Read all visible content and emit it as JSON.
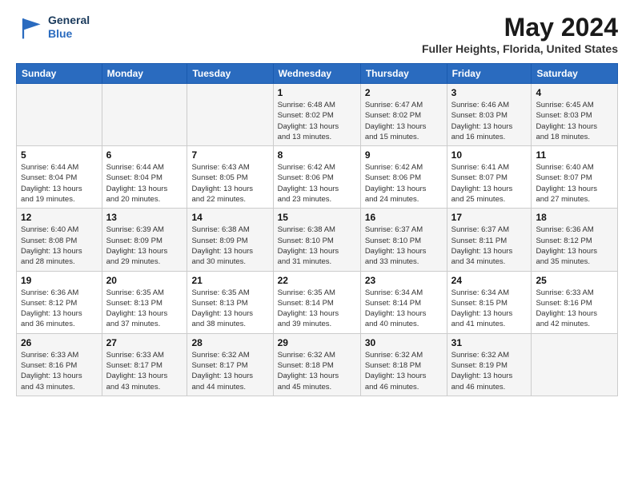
{
  "header": {
    "logo_line1": "General",
    "logo_line2": "Blue",
    "main_title": "May 2024",
    "subtitle": "Fuller Heights, Florida, United States"
  },
  "days_of_week": [
    "Sunday",
    "Monday",
    "Tuesday",
    "Wednesday",
    "Thursday",
    "Friday",
    "Saturday"
  ],
  "weeks": [
    [
      {
        "num": "",
        "info": ""
      },
      {
        "num": "",
        "info": ""
      },
      {
        "num": "",
        "info": ""
      },
      {
        "num": "1",
        "info": "Sunrise: 6:48 AM\nSunset: 8:02 PM\nDaylight: 13 hours\nand 13 minutes."
      },
      {
        "num": "2",
        "info": "Sunrise: 6:47 AM\nSunset: 8:02 PM\nDaylight: 13 hours\nand 15 minutes."
      },
      {
        "num": "3",
        "info": "Sunrise: 6:46 AM\nSunset: 8:03 PM\nDaylight: 13 hours\nand 16 minutes."
      },
      {
        "num": "4",
        "info": "Sunrise: 6:45 AM\nSunset: 8:03 PM\nDaylight: 13 hours\nand 18 minutes."
      }
    ],
    [
      {
        "num": "5",
        "info": "Sunrise: 6:44 AM\nSunset: 8:04 PM\nDaylight: 13 hours\nand 19 minutes."
      },
      {
        "num": "6",
        "info": "Sunrise: 6:44 AM\nSunset: 8:04 PM\nDaylight: 13 hours\nand 20 minutes."
      },
      {
        "num": "7",
        "info": "Sunrise: 6:43 AM\nSunset: 8:05 PM\nDaylight: 13 hours\nand 22 minutes."
      },
      {
        "num": "8",
        "info": "Sunrise: 6:42 AM\nSunset: 8:06 PM\nDaylight: 13 hours\nand 23 minutes."
      },
      {
        "num": "9",
        "info": "Sunrise: 6:42 AM\nSunset: 8:06 PM\nDaylight: 13 hours\nand 24 minutes."
      },
      {
        "num": "10",
        "info": "Sunrise: 6:41 AM\nSunset: 8:07 PM\nDaylight: 13 hours\nand 25 minutes."
      },
      {
        "num": "11",
        "info": "Sunrise: 6:40 AM\nSunset: 8:07 PM\nDaylight: 13 hours\nand 27 minutes."
      }
    ],
    [
      {
        "num": "12",
        "info": "Sunrise: 6:40 AM\nSunset: 8:08 PM\nDaylight: 13 hours\nand 28 minutes."
      },
      {
        "num": "13",
        "info": "Sunrise: 6:39 AM\nSunset: 8:09 PM\nDaylight: 13 hours\nand 29 minutes."
      },
      {
        "num": "14",
        "info": "Sunrise: 6:38 AM\nSunset: 8:09 PM\nDaylight: 13 hours\nand 30 minutes."
      },
      {
        "num": "15",
        "info": "Sunrise: 6:38 AM\nSunset: 8:10 PM\nDaylight: 13 hours\nand 31 minutes."
      },
      {
        "num": "16",
        "info": "Sunrise: 6:37 AM\nSunset: 8:10 PM\nDaylight: 13 hours\nand 33 minutes."
      },
      {
        "num": "17",
        "info": "Sunrise: 6:37 AM\nSunset: 8:11 PM\nDaylight: 13 hours\nand 34 minutes."
      },
      {
        "num": "18",
        "info": "Sunrise: 6:36 AM\nSunset: 8:12 PM\nDaylight: 13 hours\nand 35 minutes."
      }
    ],
    [
      {
        "num": "19",
        "info": "Sunrise: 6:36 AM\nSunset: 8:12 PM\nDaylight: 13 hours\nand 36 minutes."
      },
      {
        "num": "20",
        "info": "Sunrise: 6:35 AM\nSunset: 8:13 PM\nDaylight: 13 hours\nand 37 minutes."
      },
      {
        "num": "21",
        "info": "Sunrise: 6:35 AM\nSunset: 8:13 PM\nDaylight: 13 hours\nand 38 minutes."
      },
      {
        "num": "22",
        "info": "Sunrise: 6:35 AM\nSunset: 8:14 PM\nDaylight: 13 hours\nand 39 minutes."
      },
      {
        "num": "23",
        "info": "Sunrise: 6:34 AM\nSunset: 8:14 PM\nDaylight: 13 hours\nand 40 minutes."
      },
      {
        "num": "24",
        "info": "Sunrise: 6:34 AM\nSunset: 8:15 PM\nDaylight: 13 hours\nand 41 minutes."
      },
      {
        "num": "25",
        "info": "Sunrise: 6:33 AM\nSunset: 8:16 PM\nDaylight: 13 hours\nand 42 minutes."
      }
    ],
    [
      {
        "num": "26",
        "info": "Sunrise: 6:33 AM\nSunset: 8:16 PM\nDaylight: 13 hours\nand 43 minutes."
      },
      {
        "num": "27",
        "info": "Sunrise: 6:33 AM\nSunset: 8:17 PM\nDaylight: 13 hours\nand 43 minutes."
      },
      {
        "num": "28",
        "info": "Sunrise: 6:32 AM\nSunset: 8:17 PM\nDaylight: 13 hours\nand 44 minutes."
      },
      {
        "num": "29",
        "info": "Sunrise: 6:32 AM\nSunset: 8:18 PM\nDaylight: 13 hours\nand 45 minutes."
      },
      {
        "num": "30",
        "info": "Sunrise: 6:32 AM\nSunset: 8:18 PM\nDaylight: 13 hours\nand 46 minutes."
      },
      {
        "num": "31",
        "info": "Sunrise: 6:32 AM\nSunset: 8:19 PM\nDaylight: 13 hours\nand 46 minutes."
      },
      {
        "num": "",
        "info": ""
      }
    ]
  ]
}
